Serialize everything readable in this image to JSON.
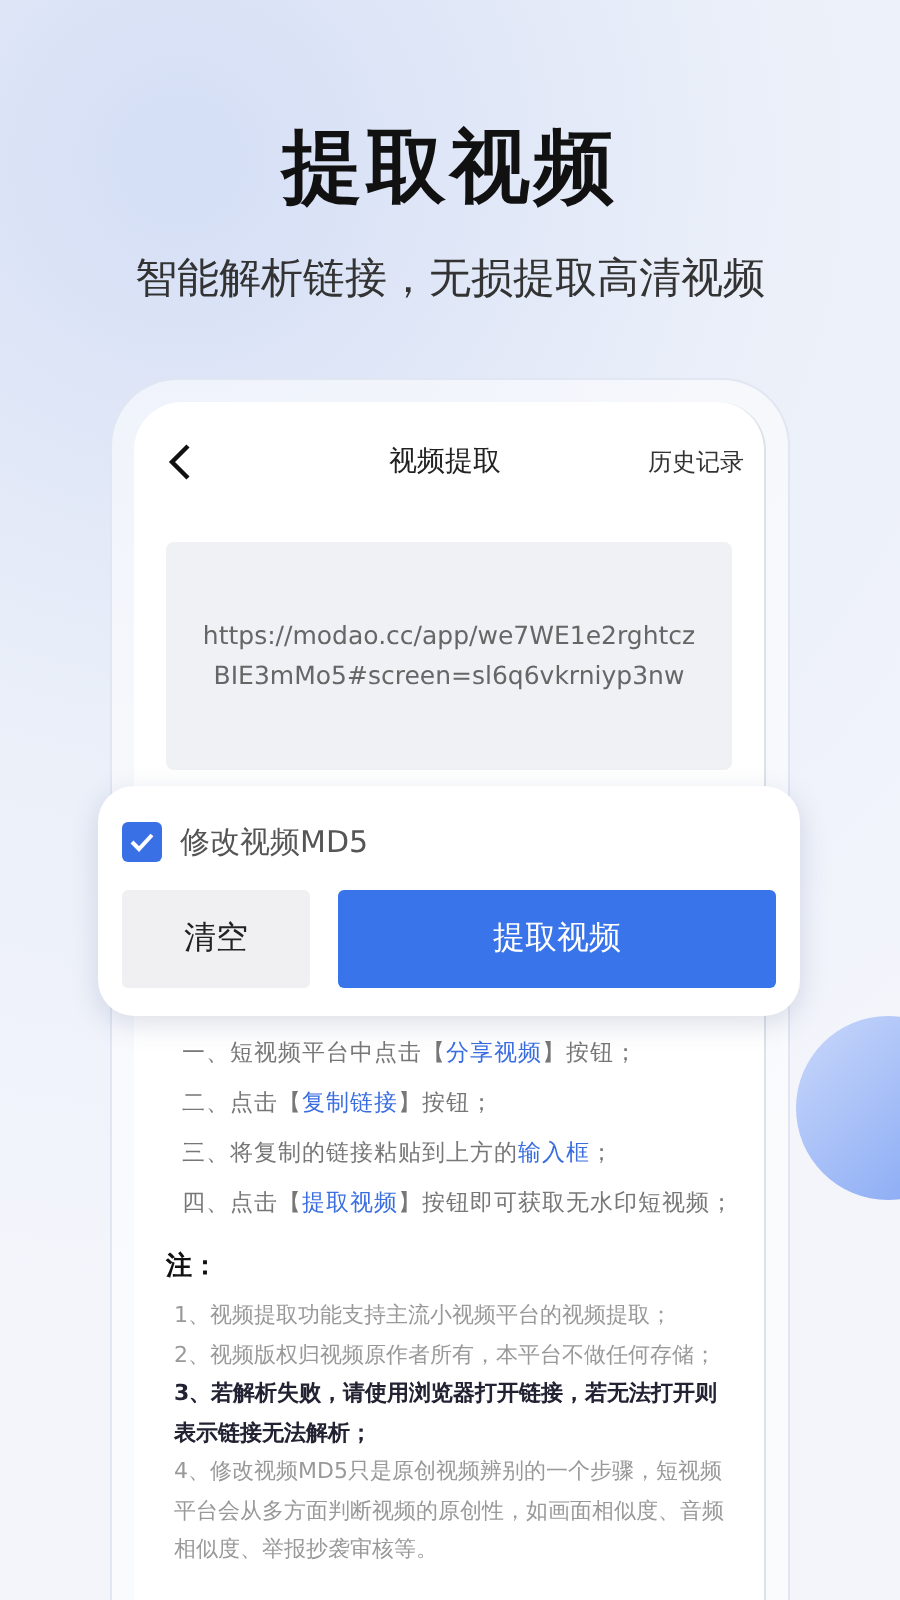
{
  "headline": "提取视频",
  "subheadline": "智能解析链接，无损提取高清视频",
  "screen": {
    "title": "视频提取",
    "history_link": "历史记录",
    "url_input": {
      "value": "https://modao.cc/app/we7WE1e2rghtczBIE3mMo5#screen=sl6q6vkrniyp3nw"
    },
    "md5_option": {
      "label": "修改视频MD5",
      "checked": true
    },
    "buttons": [
      {
        "label": "清空",
        "kind": "secondary"
      },
      {
        "label": "提取视频",
        "kind": "primary"
      }
    ],
    "steps": [
      [
        {
          "text": "一、短视频平台中点击【",
          "highlight": false
        },
        {
          "text": "分享视频",
          "highlight": true
        },
        {
          "text": "】按钮；",
          "highlight": false
        }
      ],
      [
        {
          "text": "二、点击【",
          "highlight": false
        },
        {
          "text": "复制链接",
          "highlight": true
        },
        {
          "text": "】按钮；",
          "highlight": false
        }
      ],
      [
        {
          "text": "三、将复制的链接粘贴到上方的",
          "highlight": false
        },
        {
          "text": "输入框",
          "highlight": true
        },
        {
          "text": "；",
          "highlight": false
        }
      ],
      [
        {
          "text": "四、点击【",
          "highlight": false
        },
        {
          "text": "提取视频",
          "highlight": true
        },
        {
          "text": "】按钮即可获取无水印短视频；",
          "highlight": false
        }
      ]
    ],
    "notes_title": "注：",
    "notes": [
      {
        "text": "1、视频提取功能支持主流小视频平台的视频提取；",
        "emphasized": false
      },
      {
        "text": "2、视频版权归视频原作者所有，本平台不做任何存储；",
        "emphasized": false
      },
      {
        "text": "3、若解析失败，请使用浏览器打开链接，若无法打开则表示链接无法解析；",
        "emphasized": true
      },
      {
        "text": "4、修改视频MD5只是原创视频辨别的一个步骤，短视频平台会从多方面判断视频的原创性，如画面相似度、音频相似度、举报抄袭审核等。",
        "emphasized": false
      }
    ]
  }
}
